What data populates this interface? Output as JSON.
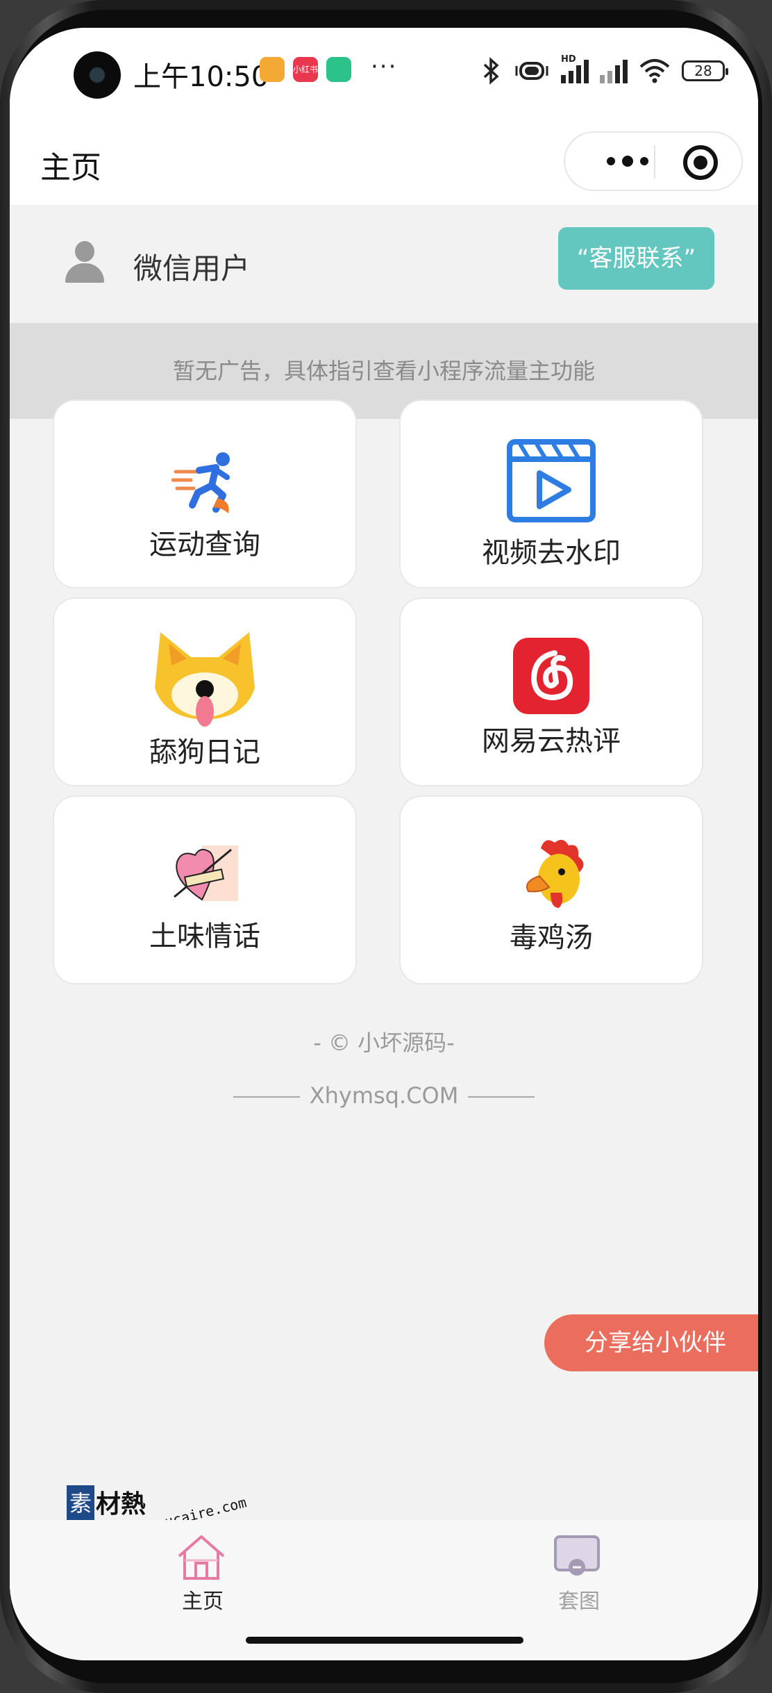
{
  "status_bar": {
    "time": "上午10:50",
    "app_badge": "小红书",
    "more": "···",
    "battery": "28",
    "hd": "HD"
  },
  "nav": {
    "title": "主页"
  },
  "user": {
    "name": "微信用户",
    "service_button": "“客服联系”"
  },
  "ad_text": "暂无广告，具体指引查看小程序流量主功能",
  "features": [
    {
      "label": "运动查询",
      "icon": "running-man-icon"
    },
    {
      "label": "视频去水印",
      "icon": "video-play-icon"
    },
    {
      "label": "舔狗日记",
      "icon": "shiba-dog-icon"
    },
    {
      "label": "网易云热评",
      "icon": "netease-music-icon"
    },
    {
      "label": "土味情话",
      "icon": "heart-arrow-icon"
    },
    {
      "label": "毒鸡汤",
      "icon": "rooster-icon"
    }
  ],
  "footer": {
    "line1": "- © 小坏源码-",
    "line2": "Xhymsq.COM"
  },
  "share_button": "分享给小伙伴",
  "watermark": {
    "mark": "素",
    "text": "材熱",
    "url": "sucaire.com"
  },
  "tabs": [
    {
      "label": "主页",
      "active": true,
      "icon": "home-icon"
    },
    {
      "label": "套图",
      "active": false,
      "icon": "gallery-icon"
    }
  ],
  "colors": {
    "accent_teal": "#63c6bf",
    "share_red": "#eb6d5d",
    "tab_active": "#e77aa3",
    "tab_inactive": "#a49ab3"
  }
}
